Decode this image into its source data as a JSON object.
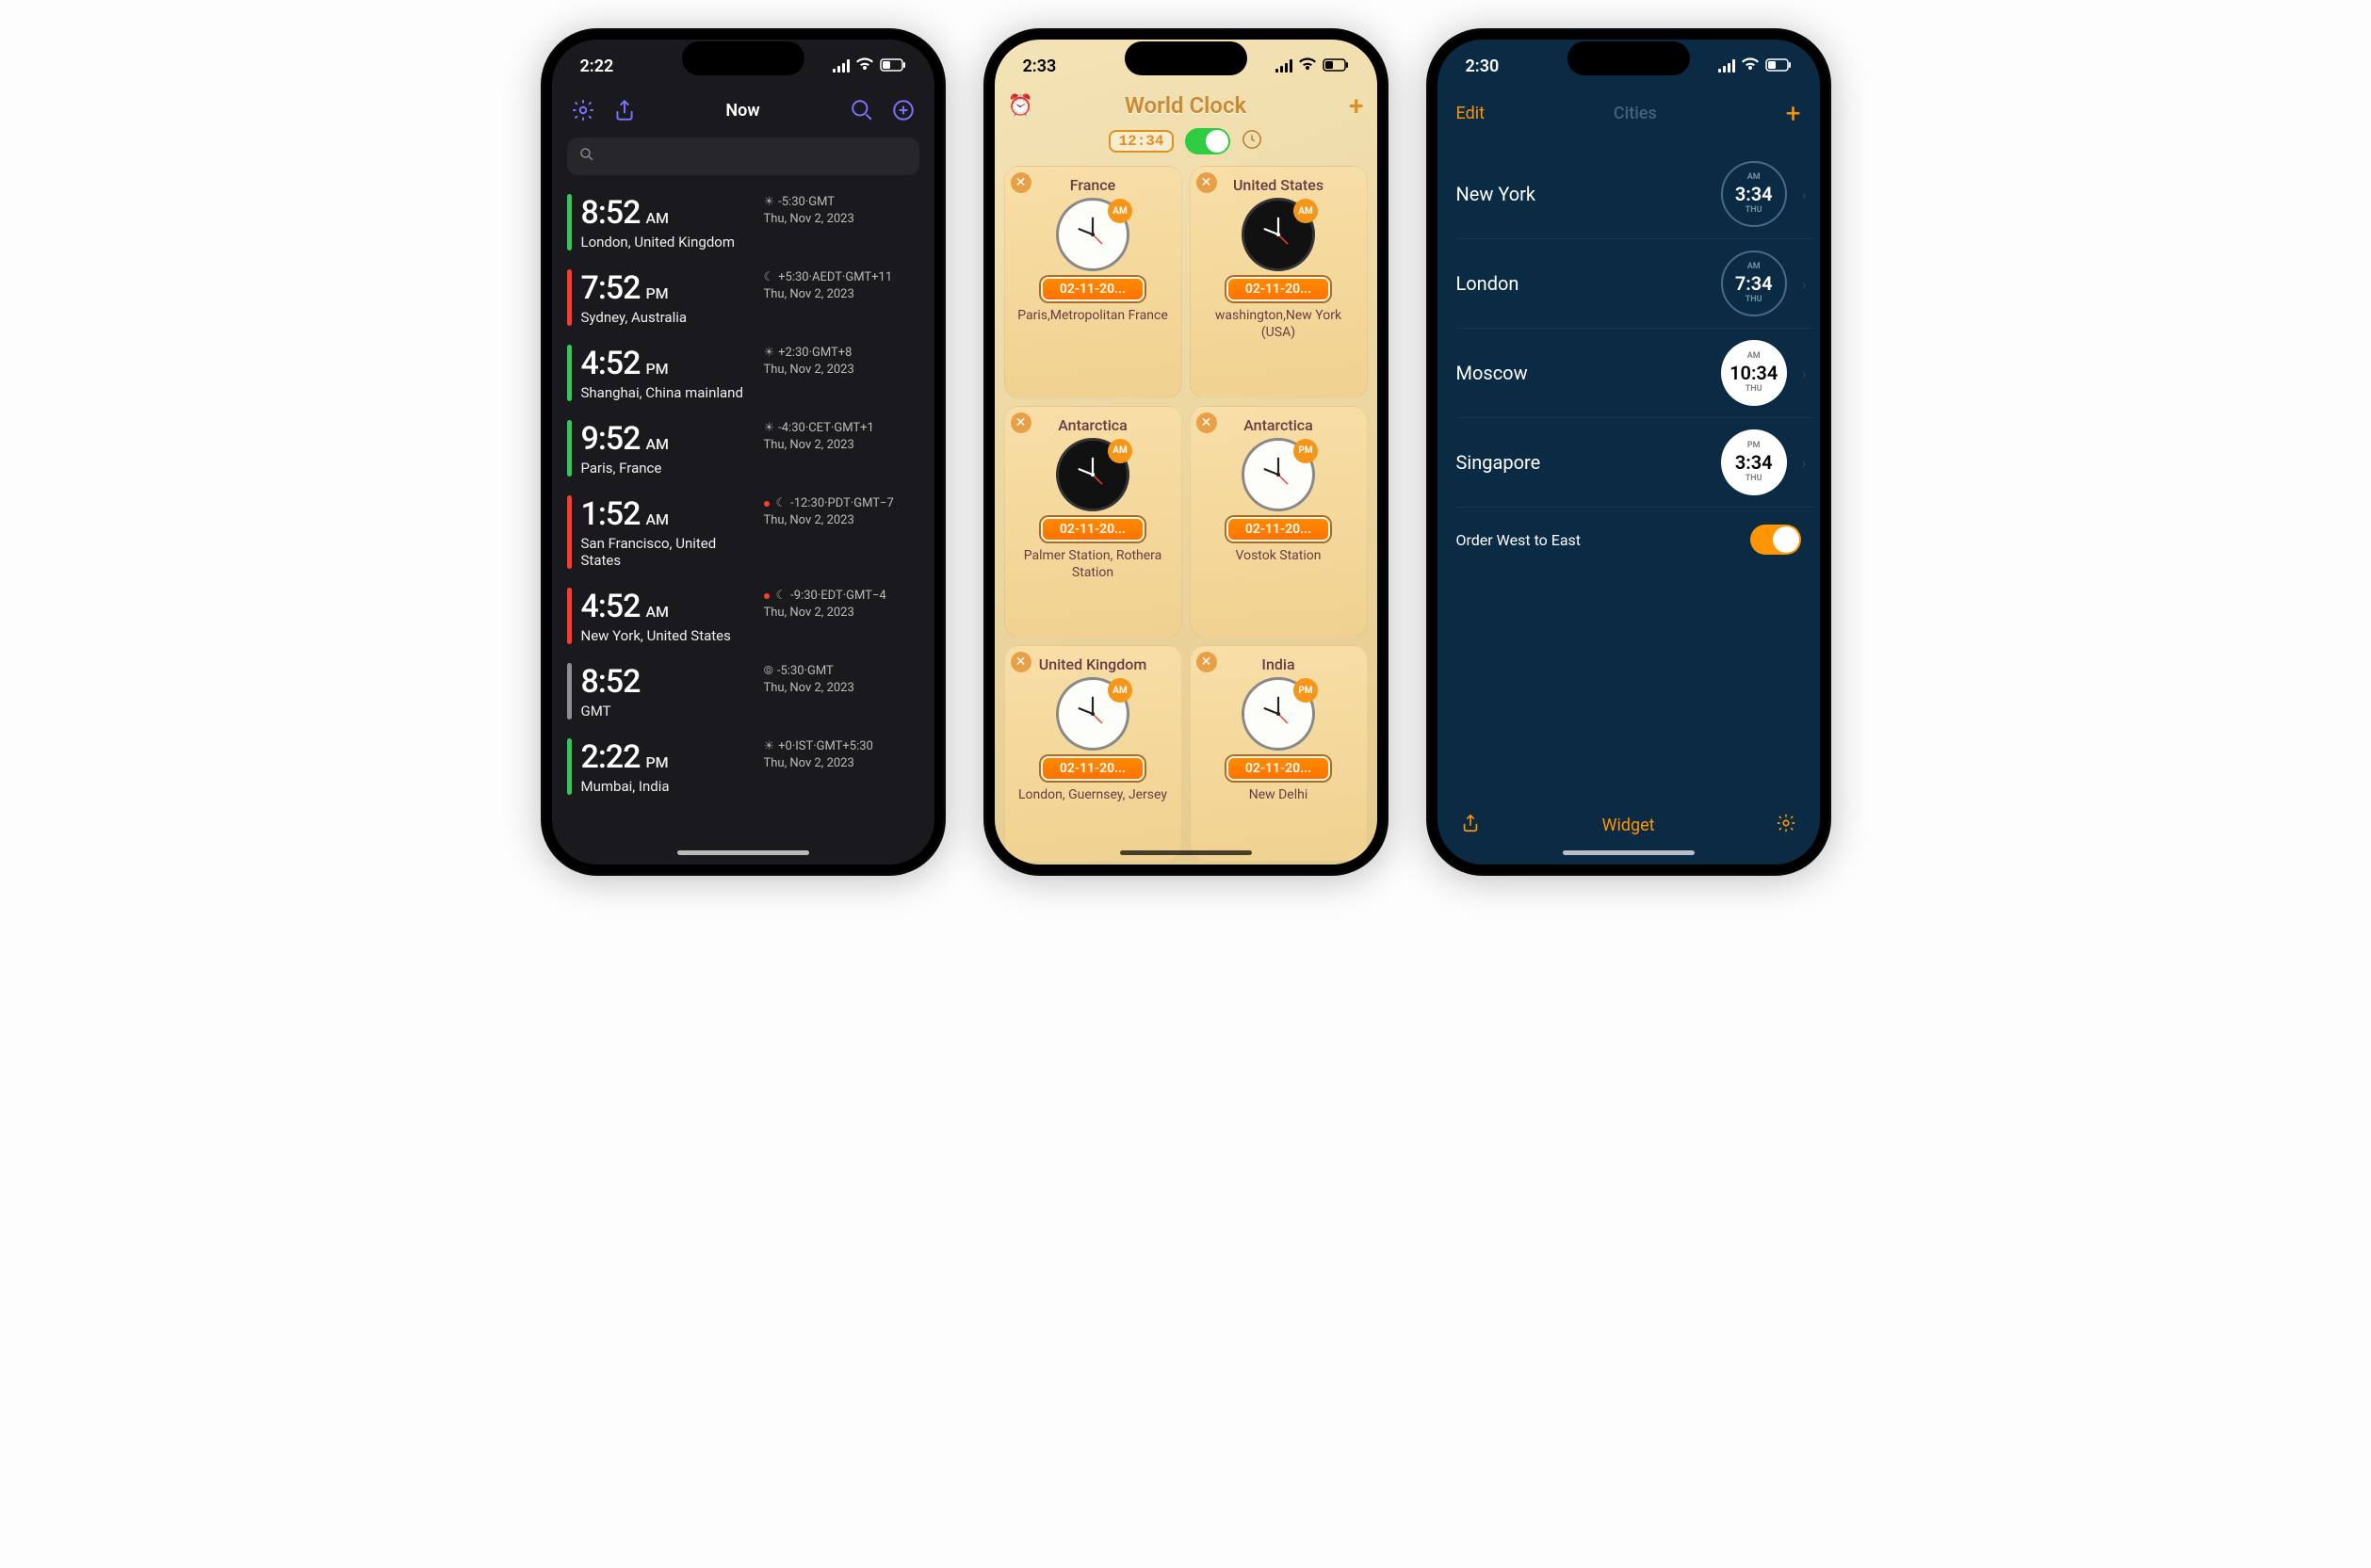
{
  "p1": {
    "status_time": "2:22",
    "title": "Now",
    "rows": [
      {
        "stripe": "green",
        "time": "8:52",
        "ampm": "AM",
        "loc": "London, United Kingdom",
        "icon": "☀",
        "meta": "-5:30·GMT",
        "date": "Thu, Nov 2, 2023",
        "dot": false
      },
      {
        "stripe": "red",
        "time": "7:52",
        "ampm": "PM",
        "loc": "Sydney, Australia",
        "icon": "☾",
        "meta": "+5:30·AEDT·GMT+11",
        "date": "Thu, Nov 2, 2023",
        "dot": false
      },
      {
        "stripe": "green",
        "time": "4:52",
        "ampm": "PM",
        "loc": "Shanghai, China mainland",
        "icon": "☀",
        "meta": "+2:30·GMT+8",
        "date": "Thu, Nov 2, 2023",
        "dot": false
      },
      {
        "stripe": "green",
        "time": "9:52",
        "ampm": "AM",
        "loc": "Paris, France",
        "icon": "☀",
        "meta": "-4:30·CET·GMT+1",
        "date": "Thu, Nov 2, 2023",
        "dot": false
      },
      {
        "stripe": "red",
        "time": "1:52",
        "ampm": "AM",
        "loc": "San Francisco, United States",
        "icon": "☾",
        "meta": "-12:30·PDT·GMT−7",
        "date": "Thu, Nov 2, 2023",
        "dot": true
      },
      {
        "stripe": "red",
        "time": "4:52",
        "ampm": "AM",
        "loc": "New York, United States",
        "icon": "☾",
        "meta": "-9:30·EDT·GMT−4",
        "date": "Thu, Nov 2, 2023",
        "dot": true
      },
      {
        "stripe": "gray",
        "time": "8:52",
        "ampm": "",
        "loc": "GMT",
        "icon": "⦾",
        "meta": "-5:30·GMT",
        "date": "Thu, Nov 2, 2023",
        "dot": false
      },
      {
        "stripe": "green",
        "time": "2:22",
        "ampm": "PM",
        "loc": "Mumbai, India",
        "icon": "☀",
        "meta": "+0·IST·GMT+5:30",
        "date": "Thu, Nov 2, 2023",
        "dot": false
      }
    ]
  },
  "p2": {
    "status_time": "2:33",
    "title": "World Clock",
    "time_badge": "12:34",
    "cards": [
      {
        "country": "France",
        "face": "light",
        "ampm": "AM",
        "date": "02-11-20...",
        "sub": "Paris,Metropolitan France"
      },
      {
        "country": "United States",
        "face": "dark",
        "ampm": "AM",
        "date": "02-11-20...",
        "sub": "washington,New York (USA)"
      },
      {
        "country": "Antarctica",
        "face": "dark",
        "ampm": "AM",
        "date": "02-11-20...",
        "sub": "Palmer Station, Rothera Station"
      },
      {
        "country": "Antarctica",
        "face": "light",
        "ampm": "PM",
        "date": "02-11-20...",
        "sub": "Vostok Station"
      },
      {
        "country": "United Kingdom",
        "face": "light",
        "ampm": "AM",
        "date": "02-11-20...",
        "sub": "London, Guernsey, Jersey"
      },
      {
        "country": "India",
        "face": "light",
        "ampm": "PM",
        "date": "02-11-20...",
        "sub": "New Delhi"
      }
    ]
  },
  "p3": {
    "status_time": "2:30",
    "edit": "Edit",
    "title": "Cities",
    "rows": [
      {
        "city": "New York",
        "ampm": "AM",
        "time": "3:34",
        "day": "THU",
        "style": "hollow"
      },
      {
        "city": "London",
        "ampm": "AM",
        "time": "7:34",
        "day": "THU",
        "style": "hollow"
      },
      {
        "city": "Moscow",
        "ampm": "AM",
        "time": "10:34",
        "day": "THU",
        "style": "solid"
      },
      {
        "city": "Singapore",
        "ampm": "PM",
        "time": "3:34",
        "day": "THU",
        "style": "solid"
      }
    ],
    "order": "Order West to East",
    "footer": "Widget"
  }
}
